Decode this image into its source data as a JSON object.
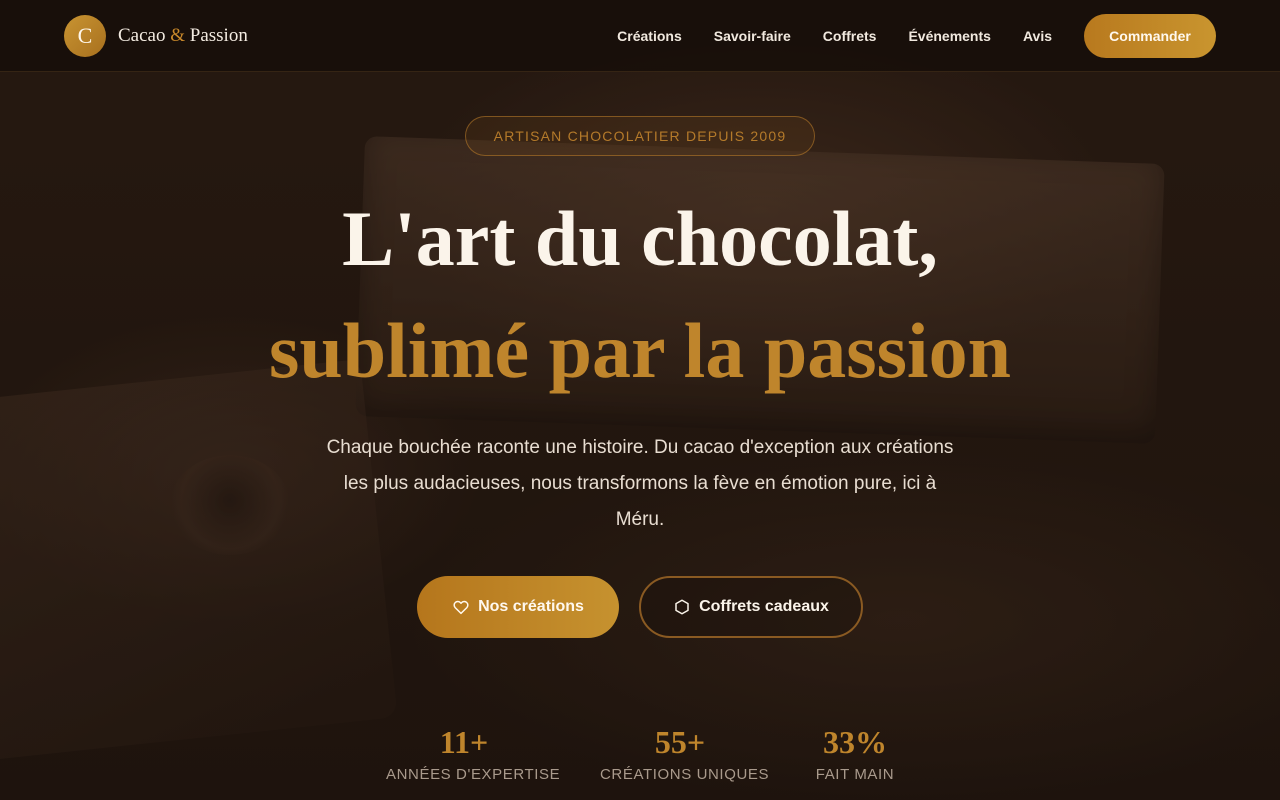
{
  "brand": {
    "logo_letter": "C",
    "name_part1": "Cacao",
    "name_amp": "&",
    "name_part2": "Passion"
  },
  "nav": {
    "links": [
      "Créations",
      "Savoir-faire",
      "Coffrets",
      "Événements",
      "Avis"
    ],
    "cta": "Commander"
  },
  "hero": {
    "badge": "ARTISAN CHOCOLATIER DEPUIS 2009",
    "title_line1": "L'art du chocolat,",
    "title_line2": "sublimé par la passion",
    "lede": "Chaque bouchée raconte une histoire. Du cacao d'exception aux créations les plus audacieuses, nous transformons la fève en émotion pure, ici à Méru.",
    "primary_button": "Nos créations",
    "primary_icon": "heart-icon",
    "secondary_button": "Coffrets cadeaux",
    "secondary_icon": "hexagon-icon"
  },
  "stats": [
    {
      "value": "11+",
      "label": "ANNÉES D'EXPERTISE"
    },
    {
      "value": "55+",
      "label": "CRÉATIONS UNIQUES"
    },
    {
      "value": "33%",
      "label": "FAIT MAIN"
    }
  ],
  "colors": {
    "accent_gold": "#bf852c",
    "background": "#1f140d",
    "text_light": "#fbf4ea"
  }
}
